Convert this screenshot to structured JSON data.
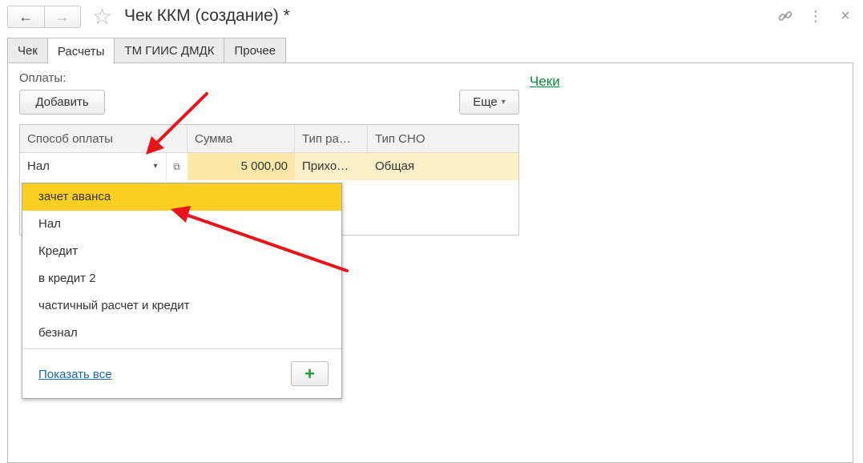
{
  "window": {
    "title": "Чек ККМ (создание) *",
    "back_icon": "←",
    "forward_icon": "→",
    "favorite_icon": "☆",
    "link_icon": "link-icon",
    "more_icon": "⋮",
    "close_icon": "×"
  },
  "tabs": [
    {
      "label": "Чек",
      "active": false
    },
    {
      "label": "Расчеты",
      "active": true
    },
    {
      "label": "ТМ ГИИС ДМДК",
      "active": false
    },
    {
      "label": "Прочее",
      "active": false
    }
  ],
  "payments": {
    "label": "Оплаты:",
    "add_button": "Добавить",
    "more_button": "Еще",
    "more_caret": "▾"
  },
  "cheki_link": "Чеки",
  "table": {
    "columns": [
      "Способ оплаты",
      "Сумма",
      "Тип ра…",
      "Тип СНО"
    ],
    "row": {
      "method": "Нал",
      "dropdown_caret": "▾",
      "open_icon": "⧉",
      "sum": "5 000,00",
      "type": "Прихо…",
      "sno": "Общая"
    }
  },
  "dropdown": {
    "items": [
      "зачет аванса",
      "Нал",
      "Кредит",
      "в кредит 2",
      "частичный расчет и кредит",
      "безнал"
    ],
    "selected_index": 0,
    "show_all": "Показать все",
    "add_icon": "+"
  },
  "colors": {
    "selected": "#f9cf22",
    "row_highlight": "#fbf0c8",
    "link_green": "#0a8a3d",
    "link_blue": "#1b67b3",
    "annotation_arrow": "#e8141c"
  }
}
